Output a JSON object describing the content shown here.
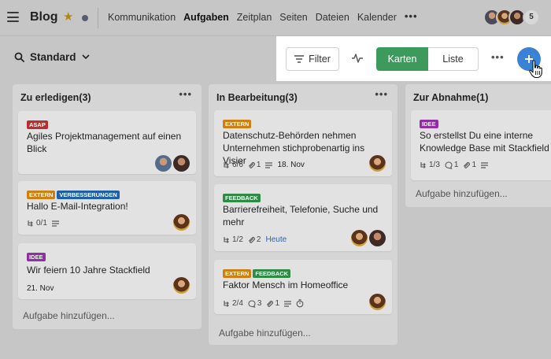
{
  "header": {
    "title": "Blog",
    "nav": [
      "Kommunikation",
      "Aufgaben",
      "Zeitplan",
      "Seiten",
      "Dateien",
      "Kalender"
    ],
    "active_nav": "Aufgaben",
    "more": "•••",
    "member_overflow": "5"
  },
  "view": {
    "selected": "Standard"
  },
  "toolbar": {
    "filter_label": "Filter",
    "cards_label": "Karten",
    "list_label": "Liste",
    "more": "•••",
    "accent_green": "#3d9a5d",
    "accent_blue": "#3a82d6"
  },
  "columns": [
    {
      "title": "Zu erledigen(3)",
      "more": "•••",
      "add_label": "Aufgabe hinzufügen...",
      "cards": [
        {
          "tags": [
            "ASAP"
          ],
          "title": "Agiles Projektmanagement auf einen Blick"
        },
        {
          "tags": [
            "EXTERN",
            "VERBESSERUNGEN"
          ],
          "title": "Hallo E-Mail-Integration!",
          "checklist": "0/1"
        },
        {
          "tags": [
            "IDEE"
          ],
          "title": "Wir feiern 10 Jahre Stackfield",
          "date": "21. Nov"
        }
      ]
    },
    {
      "title": "In Bearbeitung(3)",
      "more": "•••",
      "add_label": "Aufgabe hinzufügen...",
      "cards": [
        {
          "tags": [
            "EXTERN"
          ],
          "title": "Datenschutz-Behörden nehmen Unternehmen stichprobenartig ins Visier",
          "checklist": "6/6",
          "attachments": "1",
          "date": "18. Nov"
        },
        {
          "tags": [
            "FEEDBACK"
          ],
          "title": "Barrierefreiheit, Telefonie, Suche und mehr",
          "checklist": "1/2",
          "attachments": "2",
          "date": "Heute"
        },
        {
          "tags": [
            "EXTERN",
            "FEEDBACK"
          ],
          "title": "Faktor Mensch im Homeoffice",
          "checklist": "2/4",
          "comments": "3",
          "attachments": "1"
        }
      ]
    },
    {
      "title": "Zur Abnahme(1)",
      "add_label": "Aufgabe hinzufügen...",
      "cards": [
        {
          "tags": [
            "IDEE"
          ],
          "title": "So erstellst Du eine interne Knowledge Base mit Stackfield",
          "checklist": "1/3",
          "comments": "1",
          "attachments": "1"
        }
      ]
    }
  ],
  "icons": [
    "hamburger-icon",
    "star-icon",
    "chevron-down-icon",
    "search-icon",
    "filter-icon",
    "activity-icon",
    "plus-icon",
    "pointer-cursor-icon",
    "checklist-icon",
    "comment-icon",
    "attachment-icon",
    "description-icon",
    "timer-icon"
  ]
}
